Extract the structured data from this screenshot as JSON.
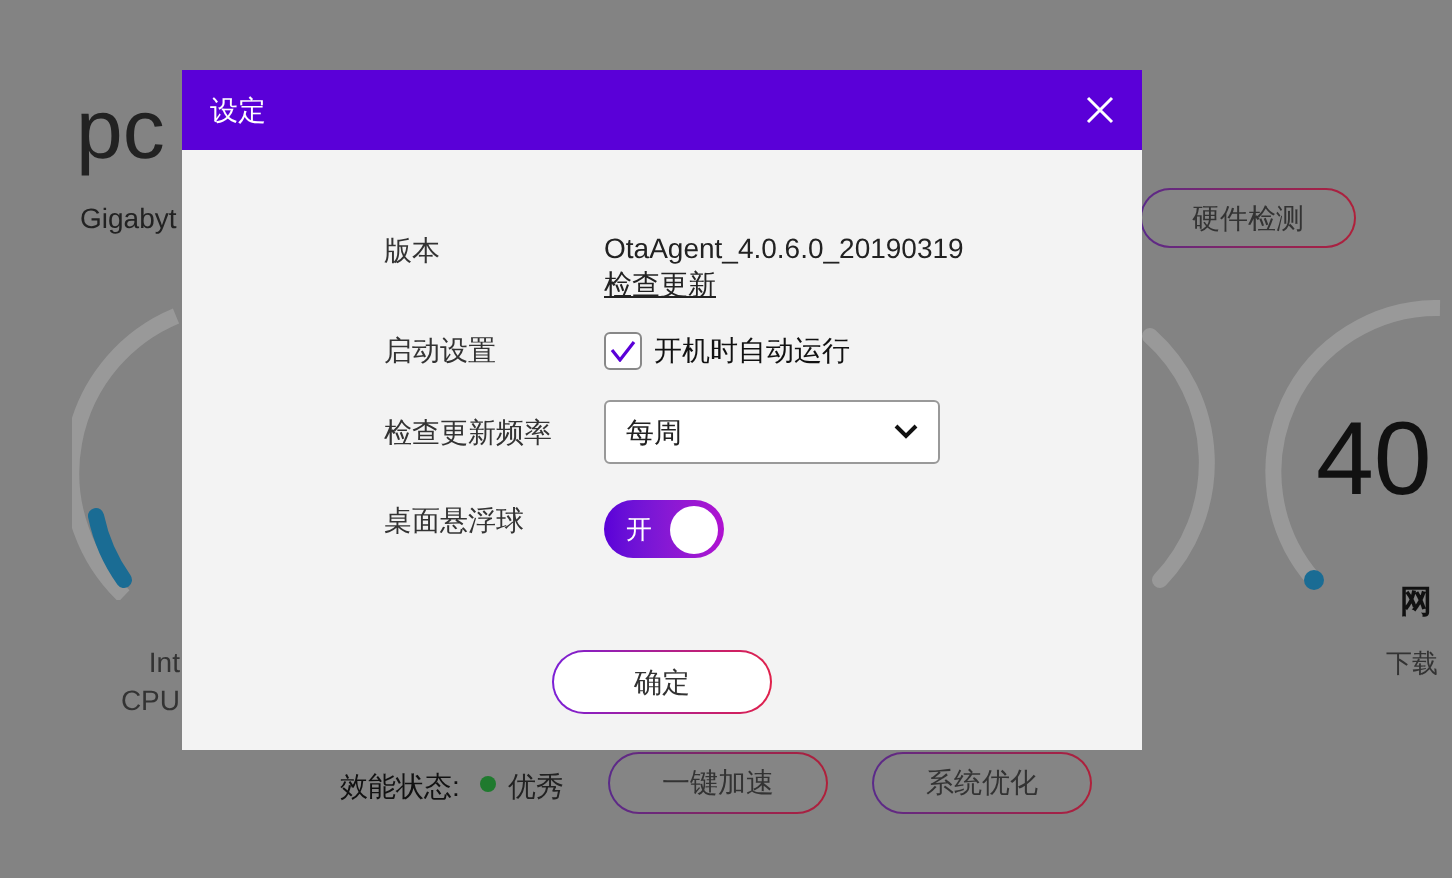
{
  "background": {
    "app_title": "pc",
    "device": "Gigabyt",
    "hardware_button": "硬件检测",
    "cpu_lines": [
      "Int",
      "CPU"
    ],
    "network": {
      "value": "40",
      "title": "网",
      "caption": "下载"
    },
    "status": {
      "label": "效能状态:",
      "color": "#1f7a2e",
      "value": "优秀"
    },
    "buttons": [
      "一键加速",
      "系统优化"
    ]
  },
  "dialog": {
    "title": "设定",
    "rows": [
      {
        "kind": "version",
        "label": "版本",
        "value": "OtaAgent_4.0.6.0_20190319",
        "link": "检查更新"
      },
      {
        "kind": "checkbox",
        "label": "启动设置",
        "text": "开机时自动运行",
        "checked": true
      },
      {
        "kind": "select",
        "label": "检查更新频率",
        "value": "每周"
      },
      {
        "kind": "toggle",
        "label": "桌面悬浮球",
        "text": "开",
        "on": true
      }
    ],
    "ok_button": "确定"
  }
}
